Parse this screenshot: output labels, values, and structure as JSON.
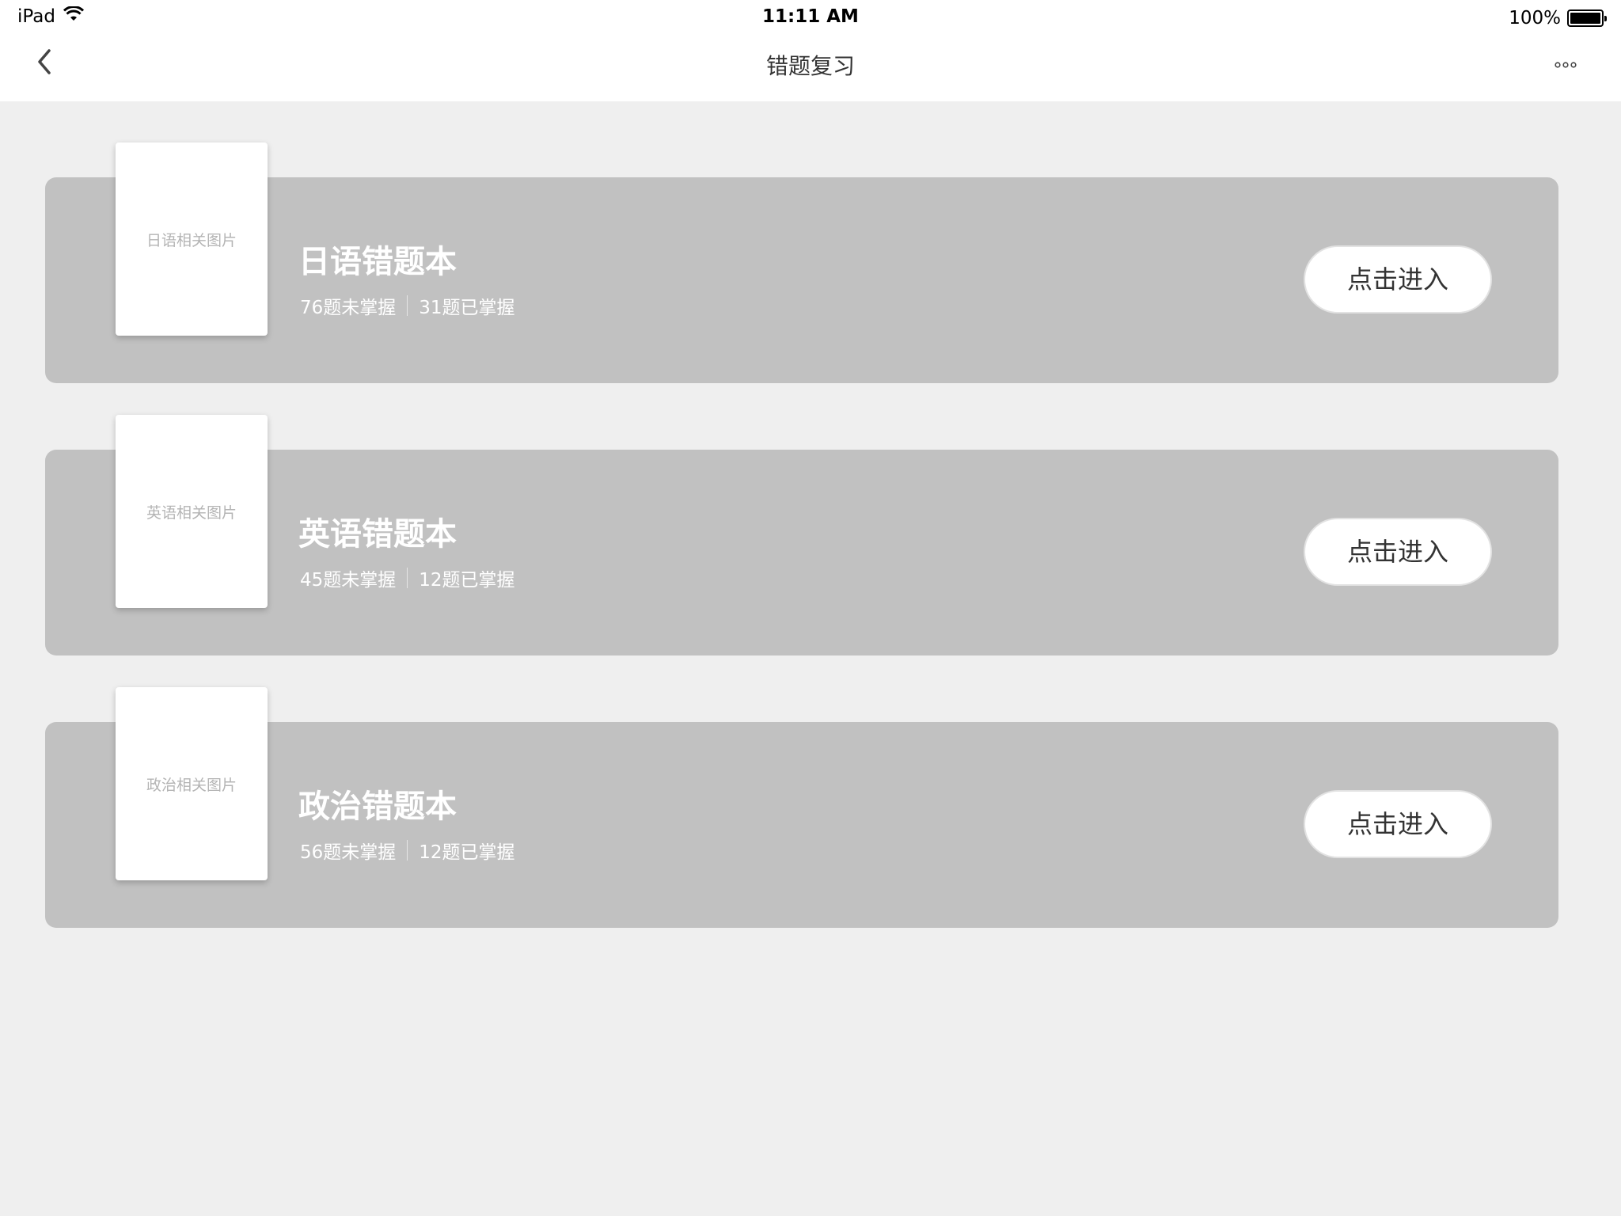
{
  "statusbar": {
    "device": "iPad",
    "time": "11:11 AM",
    "battery": "100%"
  },
  "nav": {
    "title": "错题复习"
  },
  "cards": [
    {
      "title": "日语错题本",
      "image_label": "日语相关图片",
      "unmastered": "76题未掌握",
      "mastered": "31题已掌握",
      "button": "点击进入"
    },
    {
      "title": "英语错题本",
      "image_label": "英语相关图片",
      "unmastered": "45题未掌握",
      "mastered": "12题已掌握",
      "button": "点击进入"
    },
    {
      "title": "政治错题本",
      "image_label": "政治相关图片",
      "unmastered": "56题未掌握",
      "mastered": "12题已掌握",
      "button": "点击进入"
    }
  ]
}
